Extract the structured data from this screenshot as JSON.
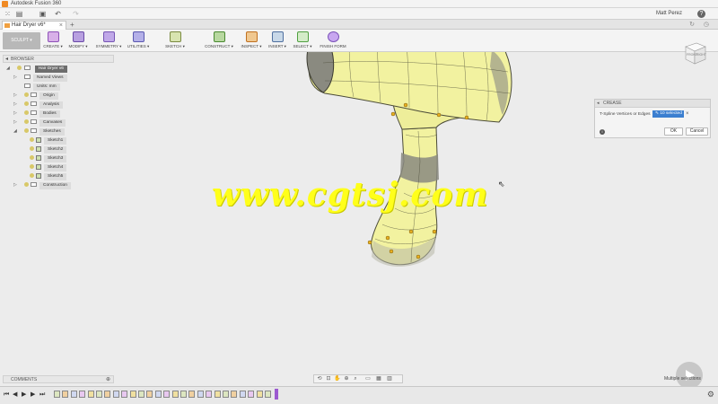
{
  "window": {
    "title": "Autodesk Fusion 360"
  },
  "quickbar": {
    "user": "Matt Perez",
    "help": "?"
  },
  "document_tab": {
    "label": "Hair Dryer v6*"
  },
  "workspace": {
    "label": "SCULPT ▾"
  },
  "toolbar": {
    "tools": [
      {
        "label": "CREATE ▾",
        "color": "#d8b0e8",
        "border": "#8e52b8"
      },
      {
        "label": "MODIFY ▾",
        "color": "#b8a0e0",
        "border": "#6a4aa8"
      },
      {
        "label": "SYMMETRY ▾",
        "color": "#c0a8e8",
        "border": "#7656b4"
      },
      {
        "label": "UTILITIES ▾",
        "color": "#b4b0e8",
        "border": "#5a58b0"
      },
      {
        "label": "SKETCH ▾",
        "color": "#d8e4b0",
        "border": "#7a8a40"
      },
      {
        "label": "CONSTRUCT ▾",
        "color": "#b8d8a0",
        "border": "#4a8a30"
      },
      {
        "label": "INSPECT ▾",
        "color": "#f0c890",
        "border": "#c07020"
      },
      {
        "label": "INSERT ▾",
        "color": "#c8d8e8",
        "border": "#5070a0"
      },
      {
        "label": "SELECT ▾",
        "color": "#d4ecc8",
        "border": "#50a040"
      },
      {
        "label": "FINISH FORM",
        "color": "#c8a6f0",
        "border": "#7a52b8"
      }
    ]
  },
  "browser": {
    "title": "BROWSER",
    "root": "Hair Dryer v6",
    "items": [
      {
        "label": "Named Views",
        "icon": "folder",
        "bulb": false
      },
      {
        "label": "Units: mm",
        "icon": "doc",
        "bulb": false
      },
      {
        "label": "Origin",
        "icon": "folder",
        "bulb": true
      },
      {
        "label": "Analysis",
        "icon": "folder",
        "bulb": true
      },
      {
        "label": "Bodies",
        "icon": "folder",
        "bulb": true
      },
      {
        "label": "Canvases",
        "icon": "folder",
        "bulb": true
      },
      {
        "label": "Sketches",
        "icon": "folder",
        "bulb": true,
        "expanded": true
      },
      {
        "label": "Sketch1",
        "icon": "sketch",
        "bulb": true,
        "child": true
      },
      {
        "label": "Sketch2",
        "icon": "sketch",
        "bulb": true,
        "child": true
      },
      {
        "label": "Sketch3",
        "icon": "sketch",
        "bulb": true,
        "child": true
      },
      {
        "label": "Sketch4",
        "icon": "sketch",
        "bulb": true,
        "child": true
      },
      {
        "label": "Sketch5",
        "icon": "sketch",
        "bulb": true,
        "child": true
      },
      {
        "label": "Construction",
        "icon": "folder",
        "bulb": true
      }
    ]
  },
  "viewcube": {
    "front": "FRONT",
    "right": "RIGHT"
  },
  "crease_dialog": {
    "title": "CREASE",
    "field_label": "T-Spline Vertices or Edges",
    "selection": "⇖ 10 selected",
    "ok": "OK",
    "cancel": "Cancel",
    "info": "i"
  },
  "watermark": {
    "text": "www.cgtsj.com"
  },
  "comments": {
    "title": "COMMENTS"
  },
  "status": {
    "text": "Multiple selections"
  },
  "colors": {
    "body_fill": "#f2f2a0",
    "body_grey": "#8a8a80",
    "edge": "#4a4a38",
    "vertex": "#e8b020",
    "watermark": "#ffff1a"
  }
}
